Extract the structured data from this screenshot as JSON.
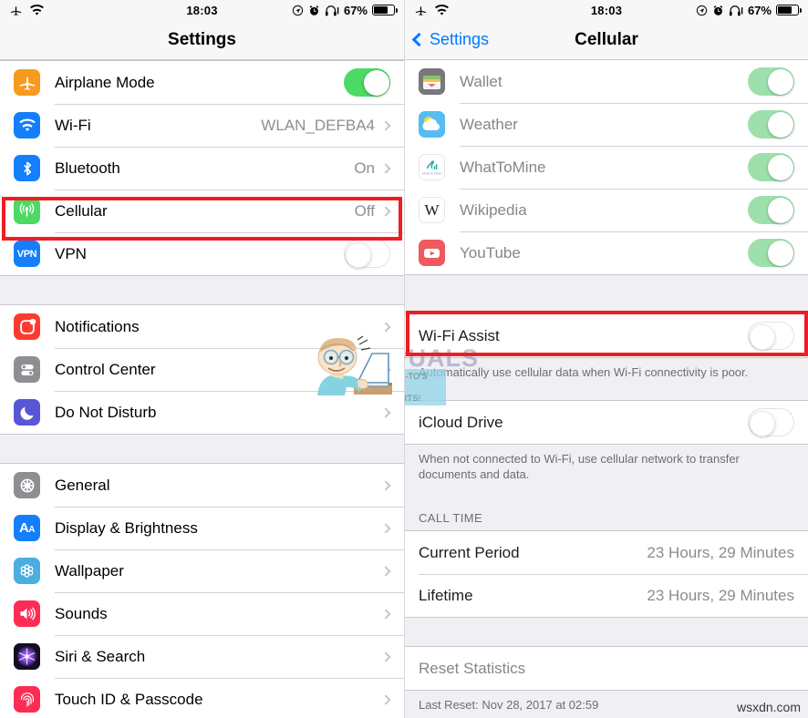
{
  "status_bar": {
    "airplane_icon": "airplane-icon",
    "wifi_icon": "wifi-icon",
    "time": "18:03",
    "location_icon": "location-icon",
    "alarm_icon": "alarm-icon",
    "headphones_icon": "headphones-icon",
    "battery_percent": "67%",
    "battery_icon": "battery-icon"
  },
  "colors": {
    "accent_blue": "#007aff",
    "toggle_green": "#4cd964",
    "highlight_red": "#ee1d23",
    "group_bg": "#efeff4",
    "separator": "#c8c7cc",
    "secondary_text": "#8e8e93"
  },
  "left_screen": {
    "nav": {
      "title": "Settings"
    },
    "group1": [
      {
        "icon": "airplane-icon",
        "label": "Airplane Mode",
        "control": "toggle",
        "on": true
      },
      {
        "icon": "wifi-icon",
        "label": "Wi-Fi",
        "control": "value",
        "value": "WLAN_DEFBA4"
      },
      {
        "icon": "bluetooth-icon",
        "label": "Bluetooth",
        "control": "value",
        "value": "On"
      },
      {
        "icon": "cellular-icon",
        "label": "Cellular",
        "control": "value",
        "value": "Off",
        "highlighted": true
      },
      {
        "icon": "vpn-icon",
        "label": "VPN",
        "control": "toggle",
        "on": false
      }
    ],
    "group2": [
      {
        "icon": "notifications-icon",
        "label": "Notifications",
        "control": "chevron"
      },
      {
        "icon": "control-center-icon",
        "label": "Control Center",
        "control": "chevron"
      },
      {
        "icon": "do-not-disturb-icon",
        "label": "Do Not Disturb",
        "control": "chevron"
      }
    ],
    "group3": [
      {
        "icon": "general-icon",
        "label": "General",
        "control": "chevron"
      },
      {
        "icon": "display-brightness-icon",
        "label": "Display & Brightness",
        "control": "chevron"
      },
      {
        "icon": "wallpaper-icon",
        "label": "Wallpaper",
        "control": "chevron"
      },
      {
        "icon": "sounds-icon",
        "label": "Sounds",
        "control": "chevron"
      },
      {
        "icon": "siri-search-icon",
        "label": "Siri & Search",
        "control": "chevron"
      },
      {
        "icon": "touch-id-icon",
        "label": "Touch ID & Passcode",
        "control": "chevron"
      }
    ]
  },
  "right_screen": {
    "nav": {
      "back_label": "Settings",
      "back_icon": "chevron-left-icon",
      "title": "Cellular"
    },
    "apps": [
      {
        "icon": "wallet-icon",
        "label": "Wallet",
        "on": true
      },
      {
        "icon": "weather-icon",
        "label": "Weather",
        "on": true
      },
      {
        "icon": "whattomine-icon",
        "label": "WhatToMine",
        "on": true
      },
      {
        "icon": "wikipedia-icon",
        "label": "Wikipedia",
        "on": true
      },
      {
        "icon": "youtube-icon",
        "label": "YouTube",
        "on": true
      }
    ],
    "wifi_assist": {
      "label": "Wi-Fi Assist",
      "on": false,
      "footer": "Automatically use cellular data when Wi-Fi connectivity is poor.",
      "highlighted": true
    },
    "icloud_drive": {
      "label": "iCloud Drive",
      "on": false,
      "footer": "When not connected to Wi-Fi, use cellular network to transfer documents and data."
    },
    "call_time": {
      "header": "CALL TIME",
      "rows": [
        {
          "label": "Current Period",
          "value": "23 Hours, 29 Minutes"
        },
        {
          "label": "Lifetime",
          "value": "23 Hours, 29 Minutes"
        }
      ]
    },
    "reset": {
      "label": "Reset Statistics",
      "footer": "Last Reset: Nov 28, 2017 at 02:59"
    }
  },
  "watermarks": {
    "brand": "APPUALS",
    "tagline_line1": "TECH HOW-TO'S FROM",
    "tagline_line2": "THE EXPERTS!",
    "site": "wsxdn.com",
    "mascot": "cartoon-man-at-laptop"
  }
}
